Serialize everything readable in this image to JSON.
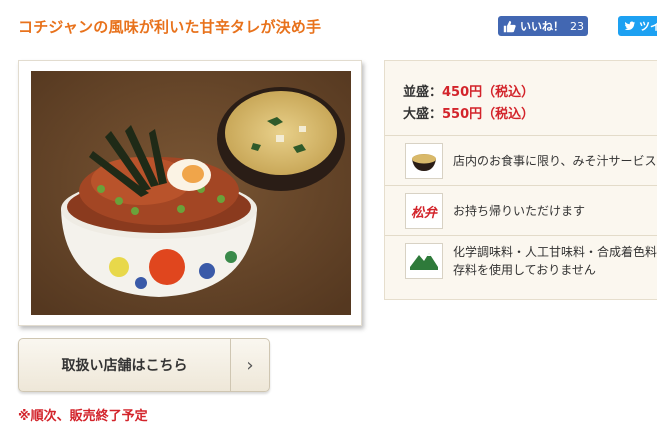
{
  "headline": "コチジャンの風味が利いた甘辛タレが決め手",
  "social": {
    "like_label": "いいね！",
    "like_count": "23",
    "tweet_label": "ツイ"
  },
  "prices": {
    "regular_label": "並盛：",
    "regular_value": "450円（税込）",
    "large_label": "大盛：",
    "large_value": "550円（税込）"
  },
  "features": [
    {
      "icon": "miso-soup-icon",
      "text": "店内のお食事に限り、みそ汁サービス"
    },
    {
      "icon": "matsuben-takeout-icon",
      "icon_text": "松弁",
      "text": "お持ち帰りいただけます"
    },
    {
      "icon": "no-additives-mountain-icon",
      "text_line1": "化学調味料・人工甘味料・合成着色料",
      "text_line2": "存料を使用しておりません"
    }
  ],
  "store_button": {
    "label": "取扱い店舗はこちら",
    "arrow": "›"
  },
  "notice": "※順次、販売終了予定",
  "colors": {
    "headline": "#e8721c",
    "price": "#d3242b",
    "notice": "#d3242b",
    "facebook": "#4267b2",
    "twitter": "#1da1f2",
    "photo_background": "#6b4a2a"
  }
}
